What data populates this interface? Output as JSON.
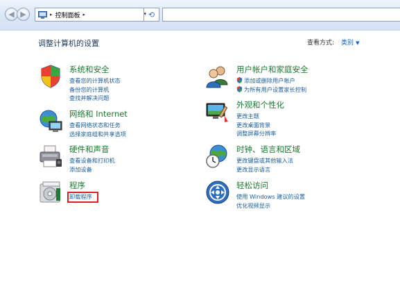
{
  "toolbar": {
    "back_icon": "back-arrow-icon",
    "forward_icon": "forward-arrow-icon",
    "address_text": "控制面板",
    "address_arrow": "▸",
    "dropdown_arrow": "▾",
    "refresh_icon": "refresh-icon",
    "search_placeholder": ""
  },
  "header": {
    "title": "调整计算机的设置",
    "view_label": "查看方式:",
    "view_value": "类别"
  },
  "categories": [
    {
      "title": "系统和安全",
      "icon": "shield-icon",
      "links": [
        "查看您的计算机状态",
        "备份您的计算机",
        "查找并解决问题"
      ]
    },
    {
      "title": "网络和 Internet",
      "icon": "network-globe-icon",
      "links": [
        "查看网络状态和任务",
        "选择家庭组和共享选项"
      ]
    },
    {
      "title": "硬件和声音",
      "icon": "printer-icon",
      "links": [
        "查看设备和打印机",
        "添加设备"
      ]
    },
    {
      "title": "程序",
      "icon": "programs-disc-icon",
      "links": [
        "卸载程序"
      ]
    },
    {
      "title": "用户帐户和家庭安全",
      "icon": "users-icon",
      "links": [
        "添加或删除用户帐户",
        "为所有用户设置家长控制"
      ]
    },
    {
      "title": "外观和个性化",
      "icon": "monitor-paint-icon",
      "links": [
        "更改主题",
        "更改桌面背景",
        "调整屏幕分辨率"
      ]
    },
    {
      "title": "时钟、语言和区域",
      "icon": "clock-globe-icon",
      "links": [
        "更改键盘或其他输入法",
        "更改显示语言"
      ]
    },
    {
      "title": "轻松访问",
      "icon": "ease-of-access-icon",
      "links": [
        "使用 Windows 建议的设置",
        "优化视频显示"
      ]
    }
  ],
  "colors": {
    "category_title": "#197b2f",
    "link": "#1a5fa0",
    "highlight_border": "#e21d23"
  }
}
